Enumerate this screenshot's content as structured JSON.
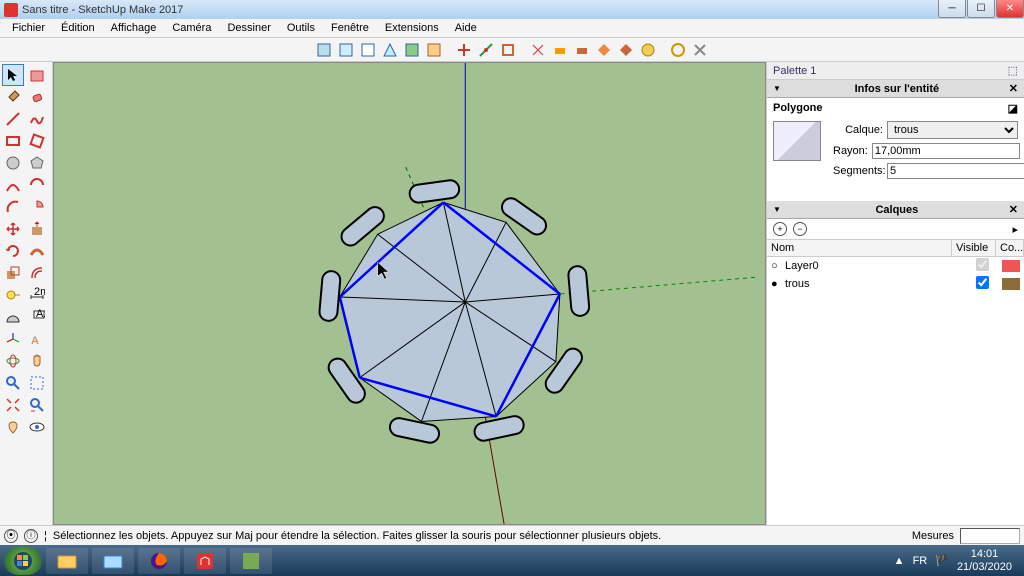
{
  "window": {
    "title": "Sans titre - SketchUp Make 2017"
  },
  "menu": [
    "Fichier",
    "Édition",
    "Affichage",
    "Caméra",
    "Dessiner",
    "Outils",
    "Fenêtre",
    "Extensions",
    "Aide"
  ],
  "palette": {
    "title": "Palette 1"
  },
  "entity": {
    "section": "Infos sur l'entité",
    "type": "Polygone",
    "layer_label": "Calque:",
    "layer_value": "trous",
    "radius_label": "Rayon:",
    "radius_value": "17,00mm",
    "segments_label": "Segments:",
    "segments_value": "5"
  },
  "layers": {
    "section": "Calques",
    "cols": {
      "name": "Nom",
      "visible": "Visible",
      "color": "Co..."
    },
    "rows": [
      {
        "name": "Layer0",
        "active": false,
        "visible": true,
        "color": "#e55"
      },
      {
        "name": "trous",
        "active": true,
        "visible": true,
        "color": "#8a6d3b"
      }
    ]
  },
  "status": {
    "hint": "Sélectionnez les objets. Appuyez sur Maj pour étendre la sélection. Faites glisser la souris pour sélectionner plusieurs objets.",
    "measures": "Mesures"
  },
  "tray": {
    "lang": "FR",
    "time": "14:01",
    "date": "21/03/2020"
  }
}
